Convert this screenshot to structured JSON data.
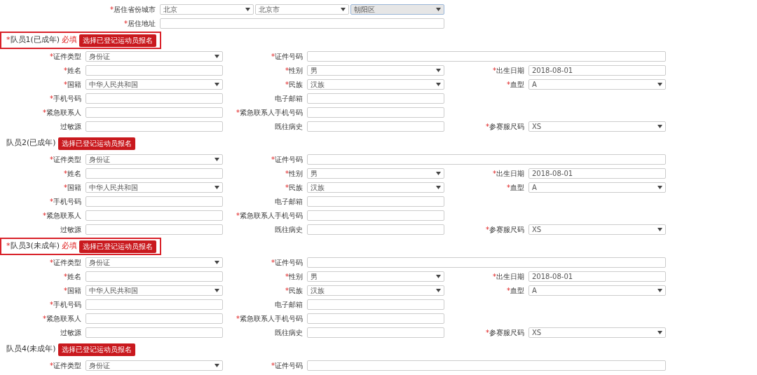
{
  "residence": {
    "city_label": "*居住省份城市",
    "city_required": true,
    "city_selects": [
      {
        "value": "北京",
        "focused": false
      },
      {
        "value": "北京市",
        "focused": false
      },
      {
        "value": "朝阳区",
        "focused": true
      }
    ],
    "address_label": "*居住地址",
    "address_required": true
  },
  "members": [
    {
      "title": "*队员1(已成年)",
      "required": true,
      "required_note": "必填",
      "highlighted": true,
      "button": "选择已登记运动员报名",
      "rows": [
        [
          {
            "kind": "select",
            "label": "*证件类型",
            "required": true,
            "value": "身份证"
          },
          {
            "kind": "input-wide",
            "label": "*证件号码",
            "required": true
          }
        ],
        [
          {
            "kind": "input",
            "label": "*姓名",
            "required": true
          },
          {
            "kind": "select",
            "label": "*性别",
            "required": true,
            "value": "男"
          },
          {
            "kind": "input",
            "label": "*出生日期",
            "required": true,
            "value": "2018-08-01"
          }
        ],
        [
          {
            "kind": "select",
            "label": "*国籍",
            "required": true,
            "value": "中华人民共和国"
          },
          {
            "kind": "select",
            "label": "*民族",
            "required": true,
            "value": "汉族"
          },
          {
            "kind": "select",
            "label": "*血型",
            "required": true,
            "value": "A"
          }
        ],
        [
          {
            "kind": "input",
            "label": "*手机号码",
            "required": true
          },
          {
            "kind": "input",
            "label": "电子邮箱",
            "required": false
          }
        ],
        [
          {
            "kind": "input",
            "label": "*紧急联系人",
            "required": true
          },
          {
            "kind": "input",
            "label": "*紧急联系人手机号码",
            "required": true
          }
        ],
        [
          {
            "kind": "input",
            "label": "过敏源",
            "required": false
          },
          {
            "kind": "input",
            "label": "既往病史",
            "required": false
          },
          {
            "kind": "select",
            "label": "*参赛服尺码",
            "required": true,
            "value": "XS"
          }
        ]
      ]
    },
    {
      "title": "队员2(已成年)",
      "required": false,
      "highlighted": false,
      "button": "选择已登记运动员报名",
      "rows": [
        [
          {
            "kind": "select",
            "label": "*证件类型",
            "required": true,
            "value": "身份证"
          },
          {
            "kind": "input-wide",
            "label": "*证件号码",
            "required": true
          }
        ],
        [
          {
            "kind": "input",
            "label": "*姓名",
            "required": true
          },
          {
            "kind": "select",
            "label": "*性别",
            "required": true,
            "value": "男"
          },
          {
            "kind": "input",
            "label": "*出生日期",
            "required": true,
            "value": "2018-08-01"
          }
        ],
        [
          {
            "kind": "select",
            "label": "*国籍",
            "required": true,
            "value": "中华人民共和国"
          },
          {
            "kind": "select",
            "label": "*民族",
            "required": true,
            "value": "汉族"
          },
          {
            "kind": "select",
            "label": "*血型",
            "required": true,
            "value": "A"
          }
        ],
        [
          {
            "kind": "input",
            "label": "*手机号码",
            "required": true
          },
          {
            "kind": "input",
            "label": "电子邮箱",
            "required": false
          }
        ],
        [
          {
            "kind": "input",
            "label": "*紧急联系人",
            "required": true
          },
          {
            "kind": "input",
            "label": "*紧急联系人手机号码",
            "required": true
          }
        ],
        [
          {
            "kind": "input",
            "label": "过敏源",
            "required": false
          },
          {
            "kind": "input",
            "label": "既往病史",
            "required": false
          },
          {
            "kind": "select",
            "label": "*参赛服尺码",
            "required": true,
            "value": "XS"
          }
        ]
      ]
    },
    {
      "title": "*队员3(未成年)",
      "required": true,
      "required_note": "必填",
      "highlighted": true,
      "button": "选择已登记运动员报名",
      "rows": [
        [
          {
            "kind": "select",
            "label": "*证件类型",
            "required": true,
            "value": "身份证"
          },
          {
            "kind": "input-wide",
            "label": "*证件号码",
            "required": true
          }
        ],
        [
          {
            "kind": "input",
            "label": "*姓名",
            "required": true
          },
          {
            "kind": "select",
            "label": "*性别",
            "required": true,
            "value": "男"
          },
          {
            "kind": "input",
            "label": "*出生日期",
            "required": true,
            "value": "2018-08-01"
          }
        ],
        [
          {
            "kind": "select",
            "label": "*国籍",
            "required": true,
            "value": "中华人民共和国"
          },
          {
            "kind": "select",
            "label": "*民族",
            "required": true,
            "value": "汉族"
          },
          {
            "kind": "select",
            "label": "*血型",
            "required": true,
            "value": "A"
          }
        ],
        [
          {
            "kind": "input",
            "label": "*手机号码",
            "required": true
          },
          {
            "kind": "input",
            "label": "电子邮箱",
            "required": false
          }
        ],
        [
          {
            "kind": "input",
            "label": "*紧急联系人",
            "required": true
          },
          {
            "kind": "input",
            "label": "*紧急联系人手机号码",
            "required": true
          }
        ],
        [
          {
            "kind": "input",
            "label": "过敏源",
            "required": false
          },
          {
            "kind": "input",
            "label": "既往病史",
            "required": false
          },
          {
            "kind": "select",
            "label": "*参赛服尺码",
            "required": true,
            "value": "XS"
          }
        ]
      ]
    },
    {
      "title": "队员4(未成年)",
      "required": false,
      "highlighted": false,
      "button": "选择已登记运动员报名",
      "rows": [
        [
          {
            "kind": "select",
            "label": "*证件类型",
            "required": true,
            "value": "身份证"
          },
          {
            "kind": "input-wide",
            "label": "*证件号码",
            "required": true
          }
        ]
      ]
    }
  ]
}
